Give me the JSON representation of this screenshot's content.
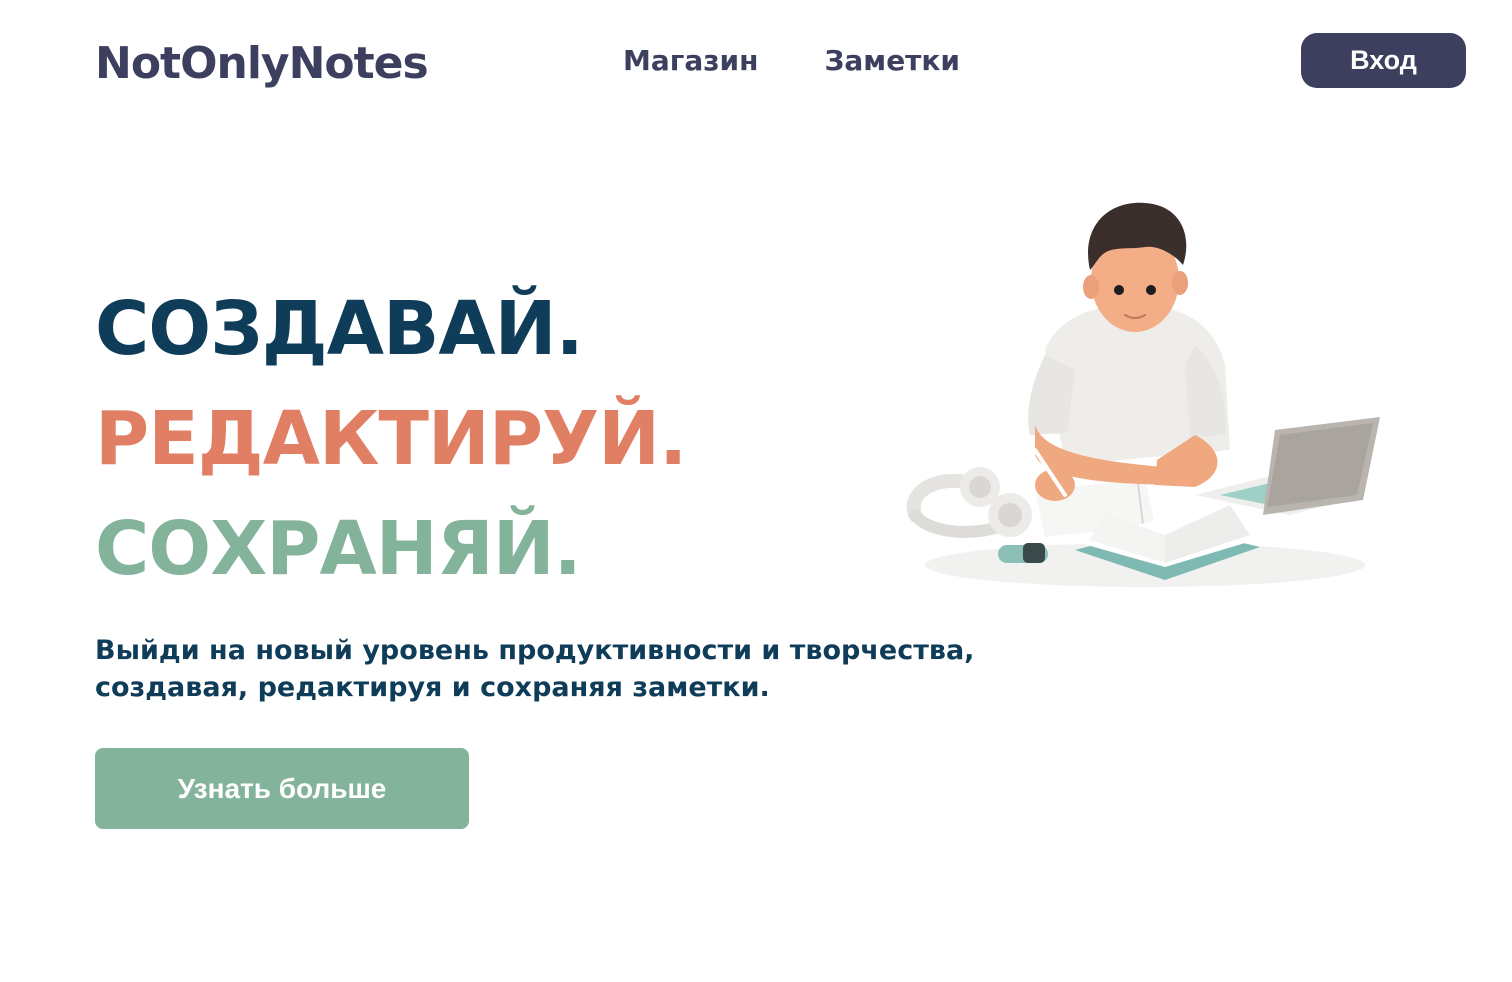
{
  "header": {
    "logo": "NotOnlyNotes",
    "nav": [
      {
        "label": "Магазин"
      },
      {
        "label": "Заметки"
      }
    ],
    "login_label": "Вход"
  },
  "hero": {
    "line1": "СОЗДАВАЙ.",
    "line2": "РЕДАКТИРУЙ.",
    "line3": "СОХРАНЯЙ.",
    "subtitle_line1": "Выйди на новый уровень продуктивности и творчества,",
    "subtitle_line2": "создавая, редактируя и сохраняя заметки.",
    "cta_label": "Узнать больше",
    "illustration": "person-writing-notes-illustration"
  },
  "colors": {
    "primary_dark": "#3d3f5e",
    "navy": "#0f3c58",
    "coral": "#e17f64",
    "sage": "#84b39b",
    "background": "#ffffff"
  }
}
